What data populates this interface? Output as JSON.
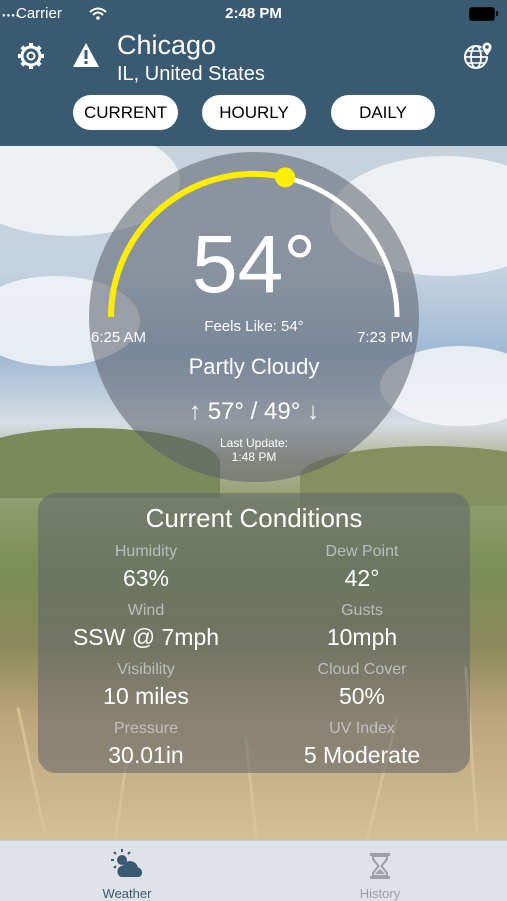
{
  "status_bar": {
    "carrier": "Carrier",
    "time": "2:48 PM"
  },
  "header": {
    "city": "Chicago",
    "region": "IL, United States",
    "tabs": [
      {
        "label": "CURRENT"
      },
      {
        "label": "HOURLY"
      },
      {
        "label": "DAILY"
      }
    ]
  },
  "current": {
    "temperature": "54°",
    "feels_like": "Feels Like: 54°",
    "sunrise": "6:25 AM",
    "sunset": "7:23 PM",
    "condition": "Partly Cloudy",
    "high_low": "↑ 57° / 49° ↓",
    "last_update_label": "Last Update:",
    "last_update_time": "1:48 PM",
    "day_progress": 0.57
  },
  "conditions": {
    "title": "Current Conditions",
    "items": [
      {
        "label": "Humidity",
        "value": "63%"
      },
      {
        "label": "Dew Point",
        "value": "42°"
      },
      {
        "label": "Wind",
        "value": "SSW @ 7mph"
      },
      {
        "label": "Gusts",
        "value": "10mph"
      },
      {
        "label": "Visibility",
        "value": "10 miles"
      },
      {
        "label": "Cloud Cover",
        "value": "50%"
      },
      {
        "label": "Pressure",
        "value": "30.01in"
      },
      {
        "label": "UV Index",
        "value": "5 Moderate"
      }
    ]
  },
  "tab_bar": {
    "items": [
      {
        "label": "Weather",
        "icon": "weather-icon",
        "active": true
      },
      {
        "label": "History",
        "icon": "hourglass-icon",
        "active": false
      }
    ]
  },
  "colors": {
    "header": "#3a5a72",
    "accent_yellow": "#ffee00",
    "tab_active": "#3a5a72",
    "tab_inactive": "#9aa0a6"
  }
}
